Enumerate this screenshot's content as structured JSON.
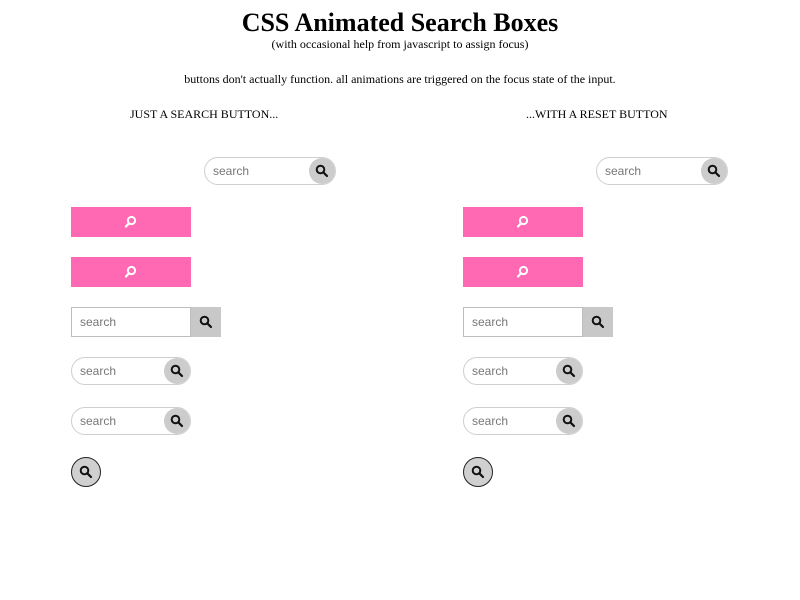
{
  "header": {
    "title": "CSS Animated Search Boxes",
    "subtitle": "(with occasional help from javascript to assign focus)",
    "note": "buttons don't actually function. all animations are triggered on the focus state of the input."
  },
  "columns": {
    "left_heading": "JUST A SEARCH BUTTON...",
    "right_heading": "...WITH A RESET BUTTON"
  },
  "search": {
    "placeholder": "search"
  },
  "colors": {
    "pink": "#ff69b4",
    "button_gray": "#cccccc",
    "border_gray": "#cfcfcf"
  },
  "icons": {
    "search": "search-icon",
    "search_white": "search-icon-white"
  }
}
